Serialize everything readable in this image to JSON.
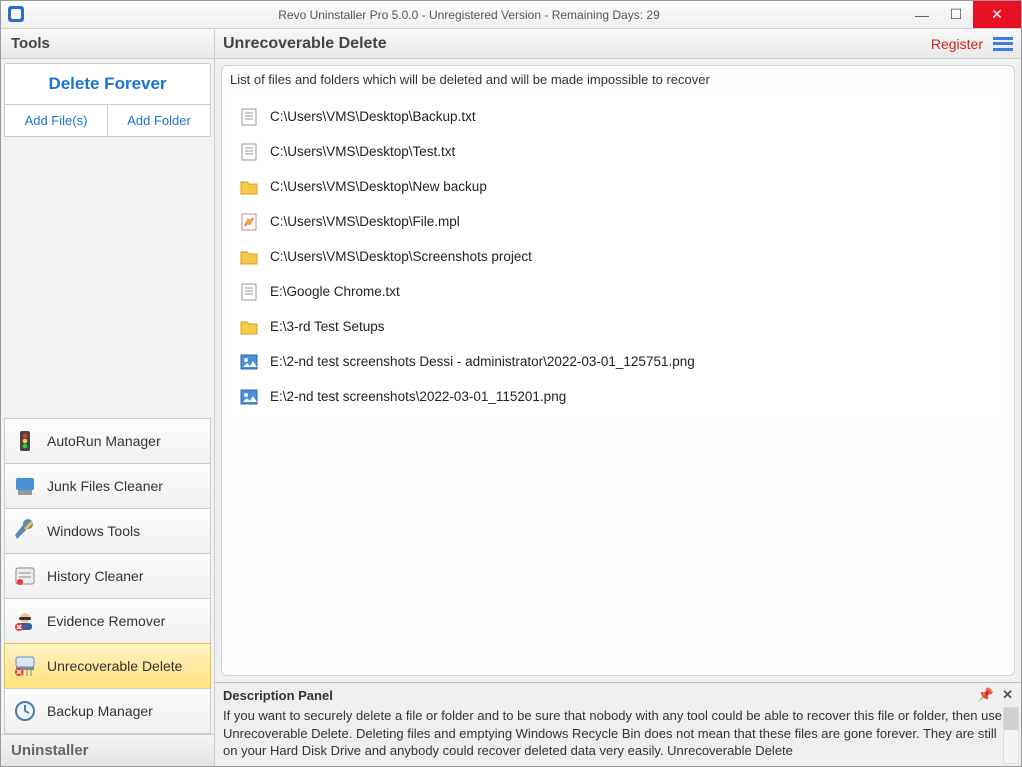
{
  "window": {
    "title": "Revo Uninstaller Pro 5.0.0 - Unregistered Version - Remaining Days: 29"
  },
  "sidebar": {
    "header": "Tools",
    "delete_forever": "Delete Forever",
    "add_files": "Add File(s)",
    "add_folder": "Add Folder",
    "tools": [
      {
        "label": "AutoRun Manager",
        "icon": "traffic-light-icon",
        "selected": false
      },
      {
        "label": "Junk Files Cleaner",
        "icon": "broom-icon",
        "selected": false
      },
      {
        "label": "Windows Tools",
        "icon": "wrench-icon",
        "selected": false
      },
      {
        "label": "History Cleaner",
        "icon": "history-icon",
        "selected": false
      },
      {
        "label": "Evidence Remover",
        "icon": "spy-icon",
        "selected": false
      },
      {
        "label": "Unrecoverable Delete",
        "icon": "shred-icon",
        "selected": true
      },
      {
        "label": "Backup Manager",
        "icon": "clock-icon",
        "selected": false
      }
    ],
    "footer": "Uninstaller"
  },
  "content": {
    "title": "Unrecoverable Delete",
    "register": "Register",
    "list_caption": "List of files and folders which will be deleted and will be made impossible to recover",
    "files": [
      {
        "type": "txt",
        "path": "C:\\Users\\VMS\\Desktop\\Backup.txt"
      },
      {
        "type": "txt",
        "path": "C:\\Users\\VMS\\Desktop\\Test.txt"
      },
      {
        "type": "folder",
        "path": "C:\\Users\\VMS\\Desktop\\New backup"
      },
      {
        "type": "mpl",
        "path": "C:\\Users\\VMS\\Desktop\\File.mpl"
      },
      {
        "type": "folder",
        "path": "C:\\Users\\VMS\\Desktop\\Screenshots project"
      },
      {
        "type": "txt",
        "path": "E:\\Google Chrome.txt"
      },
      {
        "type": "folder",
        "path": "E:\\3-rd Test Setups"
      },
      {
        "type": "png",
        "path": "E:\\2-nd test screenshots Dessi - administrator\\2022-03-01_125751.png"
      },
      {
        "type": "png",
        "path": "E:\\2-nd test screenshots\\2022-03-01_115201.png"
      }
    ]
  },
  "description": {
    "title": "Description Panel",
    "body": "If you want to securely delete a file or folder and to be sure that nobody with any tool could be able to recover this file or folder, then use Unrecoverable Delete. Deleting files and emptying Windows Recycle Bin does not mean that these files are gone forever. They are still on your Hard Disk Drive and anybody could recover deleted data very easily. Unrecoverable Delete"
  }
}
